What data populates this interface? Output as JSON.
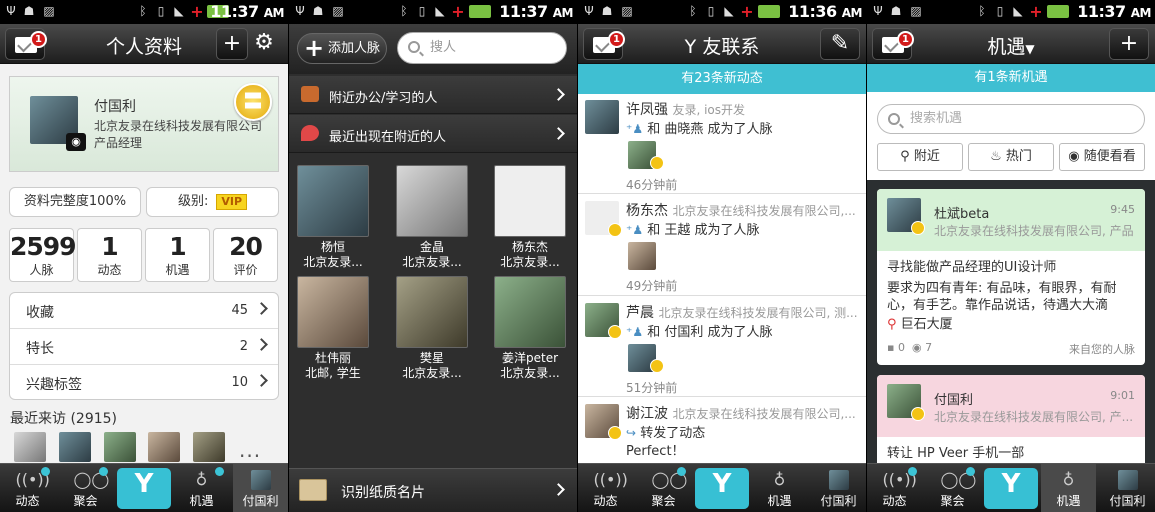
{
  "status": {
    "time1": "11:37",
    "time2": "11:37",
    "time3": "11:36",
    "time4": "11:37",
    "ampm": "AM"
  },
  "profile": {
    "title": "个人资料",
    "mail_badge": "1",
    "name": "付国利",
    "company": "北京友录在线科技发展有限公司",
    "job": "产品经理",
    "completeness": "资料完整度100%",
    "level_label": "级别:",
    "level_value": "VIP",
    "stats": [
      {
        "n": "2599",
        "l": "人脉"
      },
      {
        "n": "1",
        "l": "动态"
      },
      {
        "n": "1",
        "l": "机遇"
      },
      {
        "n": "20",
        "l": "评价"
      }
    ],
    "rows": [
      {
        "t": "收藏",
        "c": "45"
      },
      {
        "t": "特长",
        "c": "2"
      },
      {
        "t": "兴趣标签",
        "c": "10"
      }
    ],
    "visitors_title": "最近来访 (2915)",
    "more": "..."
  },
  "contacts": {
    "add_label": "添加人脉",
    "search_placeholder": "搜人",
    "nearby_office": "附近办公/学习的人",
    "recent_nearby": "最近出现在附近的人",
    "people": [
      {
        "name": "杨恒",
        "org": "北京友录..."
      },
      {
        "name": "金晶",
        "org": "北京友录..."
      },
      {
        "name": "杨东杰",
        "org": "北京友录..."
      },
      {
        "name": "杜伟丽",
        "org": "北邮, 学生"
      },
      {
        "name": "樊星",
        "org": "北京友录..."
      },
      {
        "name": "姜洋peter",
        "org": "北京友录..."
      }
    ],
    "card_scan": "识别纸质名片"
  },
  "feed": {
    "title": "友联系",
    "banner": "有23条新动态",
    "items": [
      {
        "name": "许凤强",
        "sub": "友录, ios开发",
        "act_prefix": "和",
        "act_target": "曲晓燕",
        "act_suffix": "成为了人脉",
        "time": "46分钟前"
      },
      {
        "name": "杨东杰",
        "sub": "北京友录在线科技发展有限公司,...",
        "act_prefix": "和",
        "act_target": "王越",
        "act_suffix": "成为了人脉",
        "time": "49分钟前"
      },
      {
        "name": "芦晨",
        "sub": "北京友录在线科技发展有限公司, 测...",
        "act_prefix": "和",
        "act_target": "付国利",
        "act_suffix": "成为了人脉",
        "time": "51分钟前"
      },
      {
        "name": "谢江波",
        "sub": "北京友录在线科技发展有限公司,...",
        "act_prefix": "转发了动态",
        "act_target": "",
        "act_suffix": "",
        "extra": "Perfect！"
      }
    ]
  },
  "opps": {
    "title": "机遇",
    "banner": "有1条新机遇",
    "search_placeholder": "搜索机遇",
    "filters": [
      "附近",
      "热门",
      "随便看看"
    ],
    "items": [
      {
        "name": "杜斌beta",
        "time": "9:45",
        "co": "北京友录在线科技发展有限公司, 产品",
        "title": "寻找能做产品经理的UI设计师",
        "desc1": "要求为四有青年: 有品味，有眼界，有耐",
        "desc2": "心，有手艺。靠作品说话，待遇大大滴",
        "loc": "巨石大厦",
        "comments": "0",
        "views": "7",
        "source": "来自您的人脉"
      },
      {
        "name": "付国利",
        "time": "9:01",
        "co": "北京友录在线科技发展有限公司, 产...",
        "title": "转让 HP Veer 手机一部"
      }
    ]
  },
  "tabs": {
    "feed": "动态",
    "meet": "聚会",
    "opp": "机遇",
    "me": "付国利"
  },
  "colors": {
    "accent": "#3fbfd2",
    "badge": "#d21a1a",
    "vip": "#f7d420"
  }
}
